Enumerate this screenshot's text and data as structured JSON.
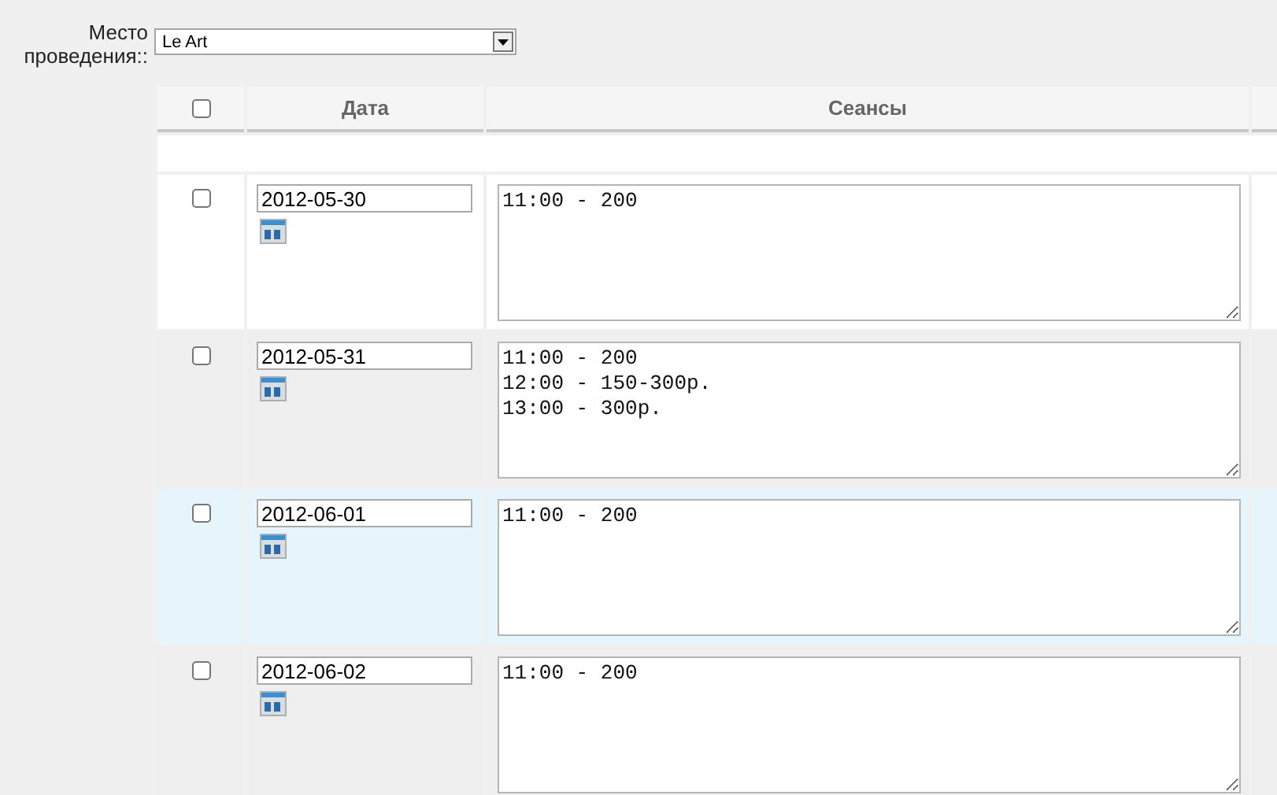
{
  "venue": {
    "label": "Место проведения::",
    "value": "Le Art"
  },
  "table": {
    "header_checkbox": {
      "checked": false
    },
    "columns": [
      "Дата",
      "Сеансы"
    ],
    "rows": [
      {
        "checked": false,
        "highlighted": false,
        "date": "2012-05-30",
        "sessions": "11:00 - 200"
      },
      {
        "checked": false,
        "highlighted": false,
        "date": "2012-05-31",
        "sessions": "11:00 - 200\n12:00 - 150-300р.\n13:00 - 300р."
      },
      {
        "checked": false,
        "highlighted": true,
        "date": "2012-06-01",
        "sessions": "11:00 - 200"
      },
      {
        "checked": false,
        "highlighted": false,
        "date": "2012-06-02",
        "sessions": "11:00 - 200"
      }
    ]
  }
}
